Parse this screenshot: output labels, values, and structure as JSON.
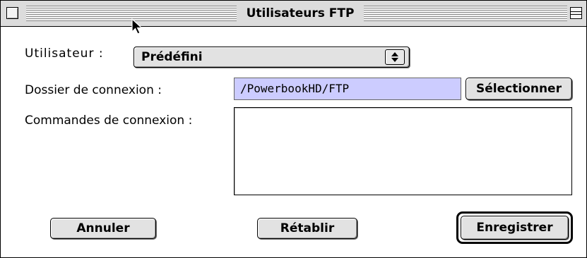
{
  "window": {
    "title": "Utilisateurs FTP"
  },
  "form": {
    "user_label": "Utilisateur :",
    "user_value": "Prédéfini",
    "folder_label": "Dossier de connexion :",
    "folder_value": "/PowerbookHD/FTP",
    "select_label": "Sélectionner",
    "commands_label": "Commandes de connexion :",
    "commands_value": ""
  },
  "buttons": {
    "cancel": "Annuler",
    "reset": "Rétablir",
    "save": "Enregistrer"
  },
  "icons": {
    "close_box": "close-box-icon",
    "collapse_box": "collapse-box-icon",
    "popup_arrows": "updown-arrows-icon",
    "cursor": "arrow-cursor-icon"
  },
  "colors": {
    "path_field_background": "#ccccff",
    "titlebar_background": "#dcdcdc",
    "button_face": "#e2e2e2"
  }
}
